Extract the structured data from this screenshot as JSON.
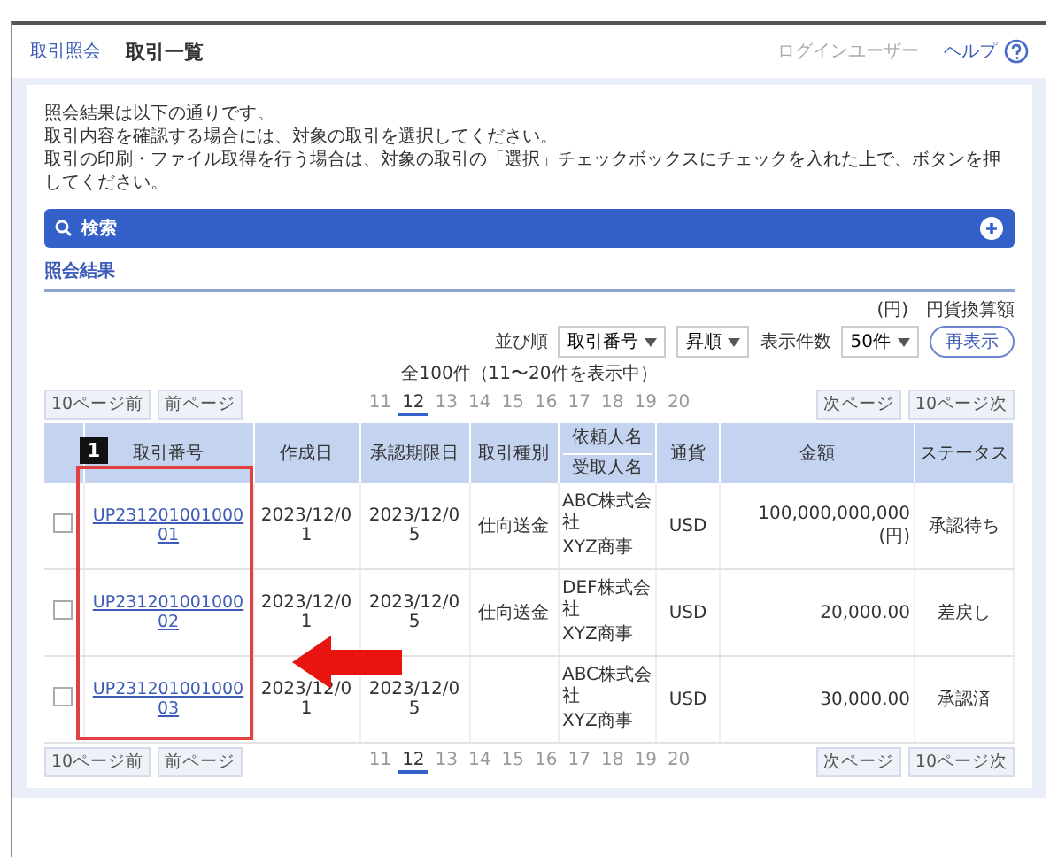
{
  "header": {
    "breadcrumb": "取引照会",
    "title": "取引一覧",
    "user": "ログインユーザー",
    "help": "ヘルプ"
  },
  "notice": [
    "照会結果は以下の通りです。",
    "取引内容を確認する場合には、対象の取引を選択してください。",
    "取引の印刷・ファイル取得を行う場合は、対象の取引の「選択」チェックボックスにチェックを入れた上で、ボタンを押してください。"
  ],
  "search_bar": {
    "label": "検索",
    "expanded": false
  },
  "section_title": "照会結果",
  "legend": [
    "(円)",
    "円貨換算額"
  ],
  "sort": {
    "label": "並び順",
    "field": "取引番号",
    "order": "昇順",
    "count_label": "表示件数",
    "count": "50件",
    "button": "再表示"
  },
  "result_info": "全100件（11〜20件を表示中）",
  "paginations": [
    {
      "first": "10ページ前",
      "prev": "前ページ",
      "next": "次ページ",
      "last": "10ページ次",
      "pages": [
        {
          "label": "11",
          "selected": false
        },
        {
          "label": "12",
          "selected": true
        },
        {
          "label": "13",
          "selected": false
        },
        {
          "label": "14",
          "selected": false
        },
        {
          "label": "15",
          "selected": false
        },
        {
          "label": "16",
          "selected": false
        },
        {
          "label": "17",
          "selected": false
        },
        {
          "label": "18",
          "selected": false
        },
        {
          "label": "19",
          "selected": false
        },
        {
          "label": "20",
          "selected": false
        }
      ]
    },
    {
      "first": "10ページ前",
      "prev": "前ページ",
      "next": "次ページ",
      "last": "10ページ次",
      "pages": [
        {
          "label": "11",
          "selected": false
        },
        {
          "label": "12",
          "selected": true
        },
        {
          "label": "13",
          "selected": false
        },
        {
          "label": "14",
          "selected": false
        },
        {
          "label": "15",
          "selected": false
        },
        {
          "label": "16",
          "selected": false
        },
        {
          "label": "17",
          "selected": false
        },
        {
          "label": "18",
          "selected": false
        },
        {
          "label": "19",
          "selected": false
        },
        {
          "label": "20",
          "selected": false
        }
      ]
    }
  ],
  "table": {
    "columns": [
      "取引番号",
      "作成日",
      "承認期限日",
      "取引種別",
      "依頼人名",
      "受取人名",
      "通貨",
      "金額",
      "ステータス"
    ],
    "rows": [
      {
        "checked": false,
        "id": "UP23120100100001",
        "date": "2023/12/01",
        "deadline": "2023/12/05",
        "type": "仕向送金",
        "parties": [
          "ABC株式会社",
          "XYZ商事"
        ],
        "currency": "USD",
        "amount": "100,000,000,000 (円)",
        "status": "承認待ち"
      },
      {
        "checked": false,
        "id": "UP23120100100002",
        "date": "2023/12/01",
        "deadline": "2023/12/05",
        "type": "仕向送金",
        "parties": [
          "DEF株式会社",
          "XYZ商事"
        ],
        "currency": "USD",
        "amount": "20,000.00",
        "status": "差戻し"
      },
      {
        "checked": false,
        "id": "UP23120100100003",
        "date": "2023/12/01",
        "deadline": "2023/12/05",
        "parties": [
          "ABC株式会社",
          "XYZ商事"
        ],
        "currency": "USD",
        "amount": "30,000.00",
        "status": "承認済"
      }
    ]
  },
  "annotation": {
    "badge": "1"
  }
}
